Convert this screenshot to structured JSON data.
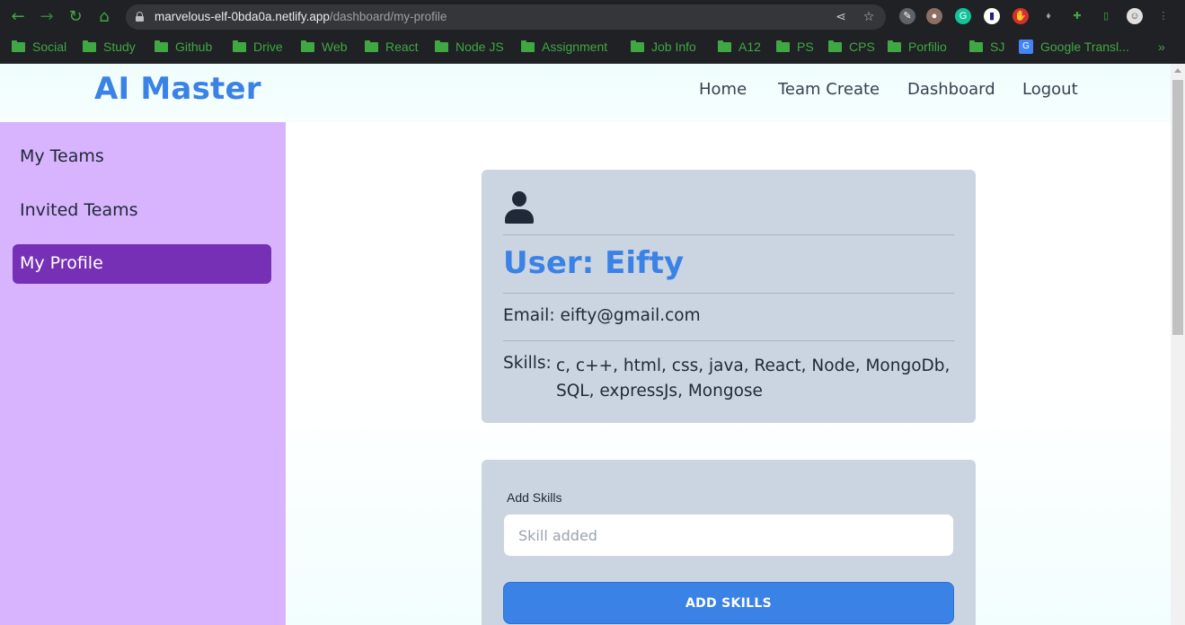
{
  "browser": {
    "url_host": "marvelous-elf-0bda0a.netlify.app",
    "url_path": "/dashboard/my-profile",
    "bookmarks": [
      "Social",
      "Study",
      "Github",
      "Drive",
      "Web",
      "React",
      "Node JS",
      "Assignment",
      "Job Info",
      "A12",
      "PS",
      "CPS",
      "Porfilio",
      "SJ"
    ],
    "translate_bookmark": "Google Transl...",
    "more_bookmarks": "»"
  },
  "header": {
    "brand": "AI Master",
    "nav": [
      "Home",
      "Team Create",
      "Dashboard",
      "Logout"
    ]
  },
  "sidebar": {
    "items": [
      "My Teams",
      "Invited Teams",
      "My Profile"
    ],
    "active_index": 2
  },
  "profile": {
    "title": "User: Eifty",
    "email_line": "Email: eifty@gmail.com",
    "skills_label": "Skills:",
    "skills_list": "c, c++, html, css, java, React, Node, MongoDb, SQL, expressJs, Mongose"
  },
  "form": {
    "label": "Add Skills",
    "placeholder": "Skill added",
    "value": "",
    "button": "ADD SKILLS"
  },
  "colors": {
    "accent": "#3b82e6",
    "sidebar_bg": "#d8b4fe",
    "sidebar_active": "#7530b5",
    "card_bg": "#cbd5e1"
  }
}
